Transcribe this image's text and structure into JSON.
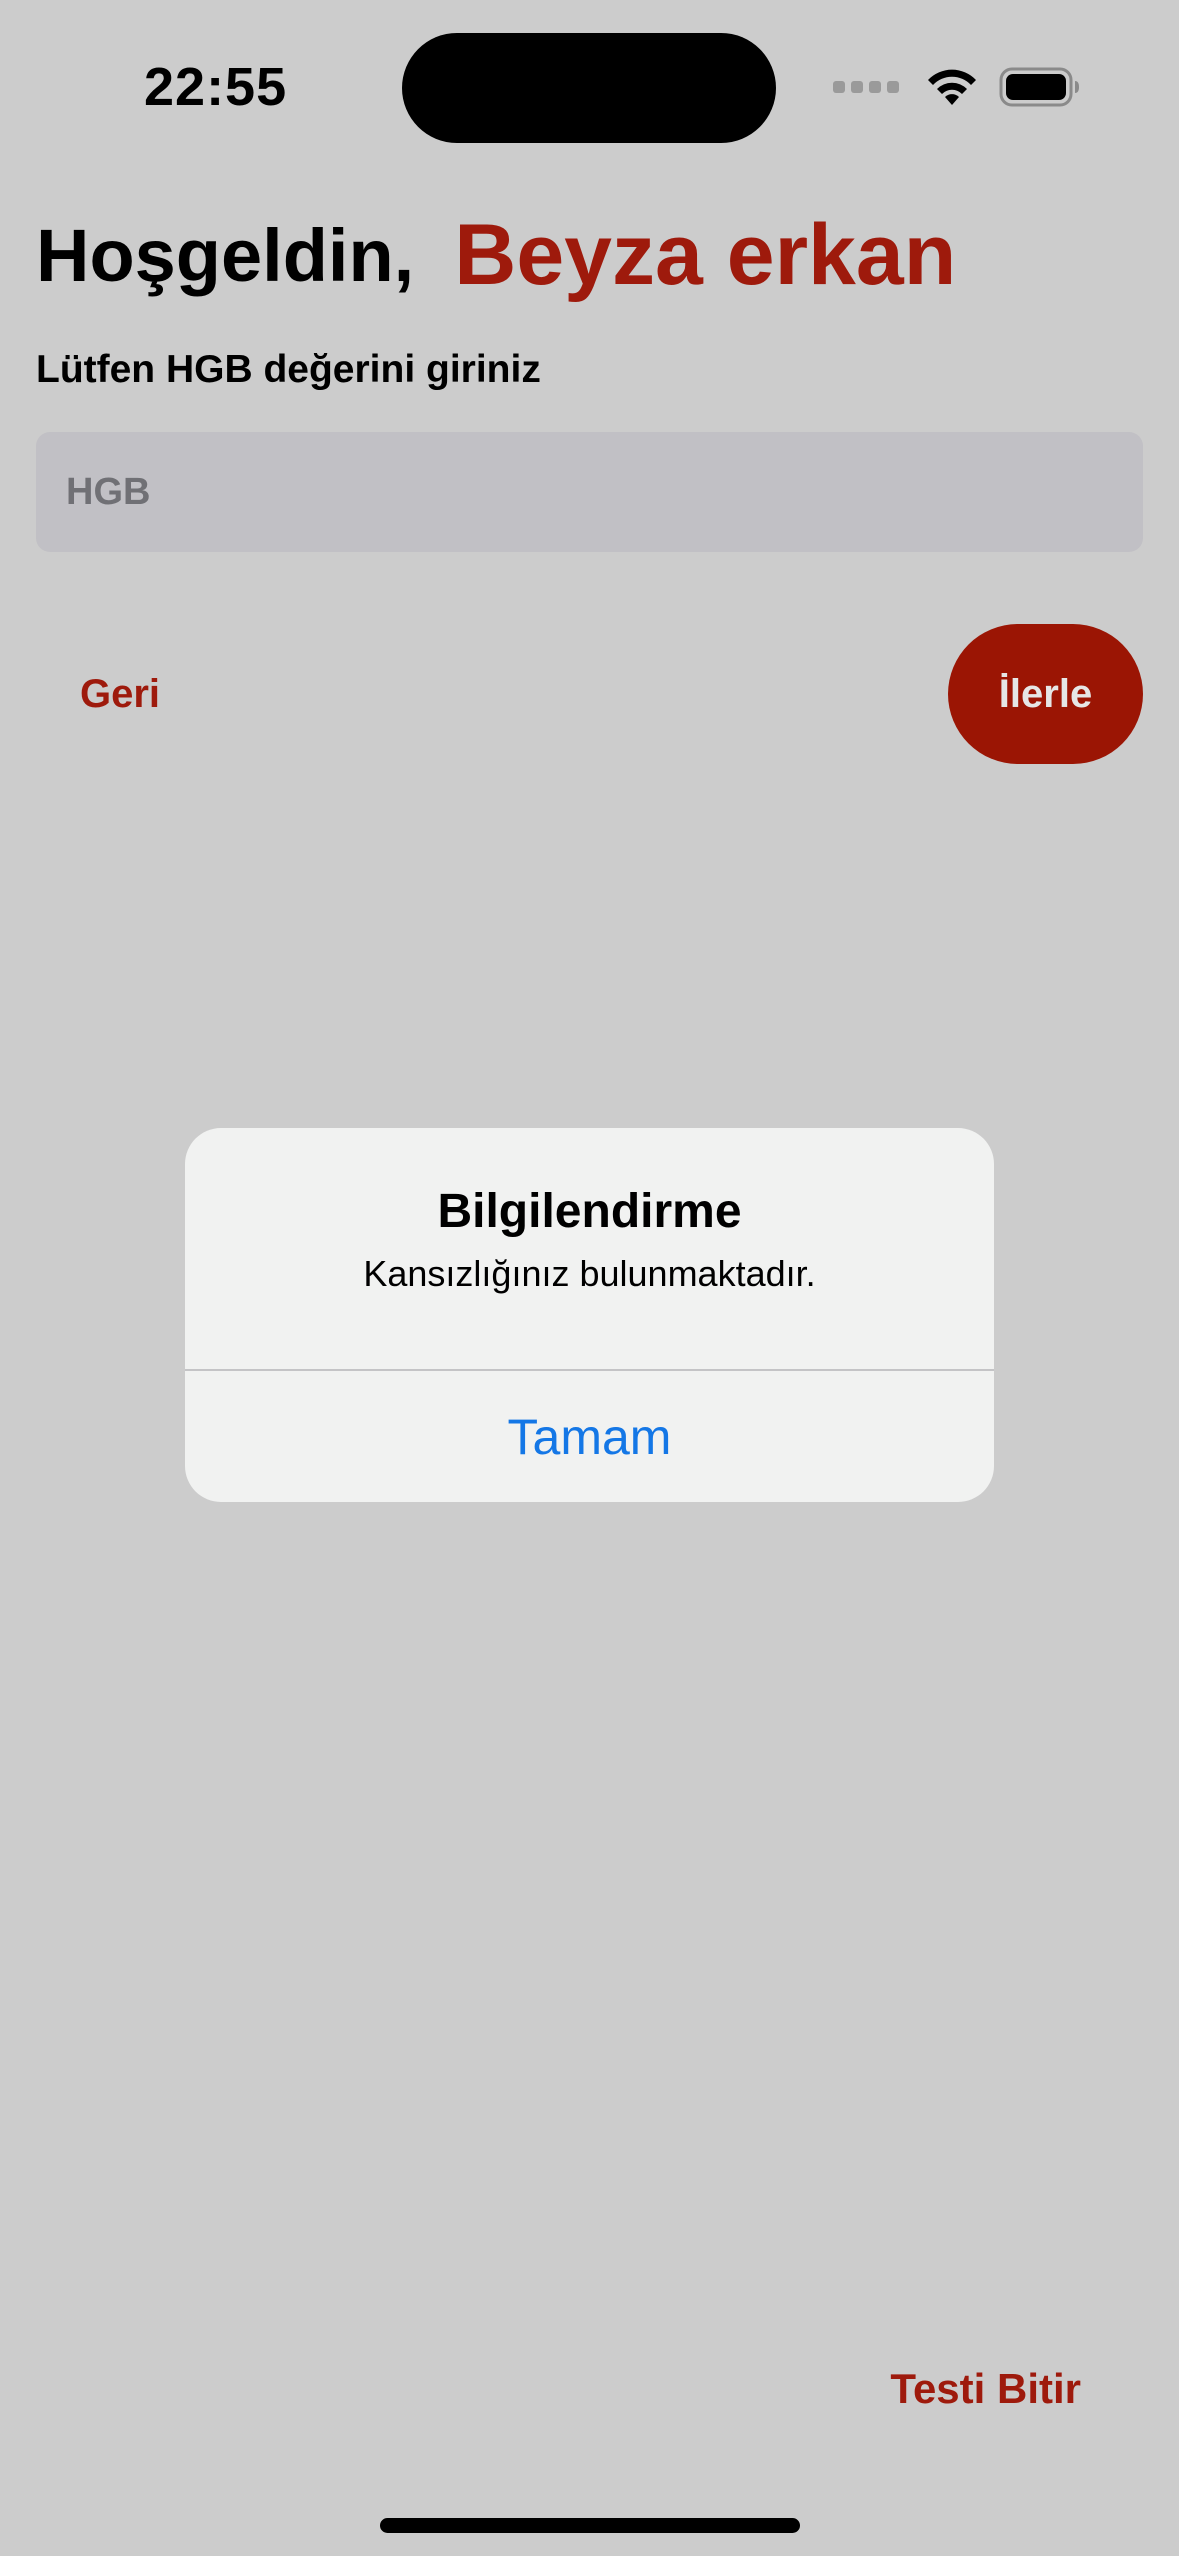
{
  "status_bar": {
    "time": "22:55"
  },
  "header": {
    "greeting": "Hoşgeldin,",
    "user_name": "Beyza erkan"
  },
  "form": {
    "prompt": "Lütfen HGB değerini giriniz",
    "hgb_input": {
      "placeholder": "HGB",
      "value": ""
    }
  },
  "buttons": {
    "back_label": "Geri",
    "next_label": "İlerle",
    "finish_label": "Testi Bitir"
  },
  "alert": {
    "title": "Bilgilendirme",
    "message": "Kansızlığınız bulunmaktadır.",
    "ok_label": "Tamam"
  },
  "colors": {
    "background": "#cccccc",
    "accent": "#9e1a0c",
    "alert_action": "#1477e6",
    "input_background": "#c1c0c5"
  },
  "icons": {
    "cellular": "cellular-signal-icon",
    "wifi": "wifi-icon",
    "battery": "battery-icon"
  }
}
